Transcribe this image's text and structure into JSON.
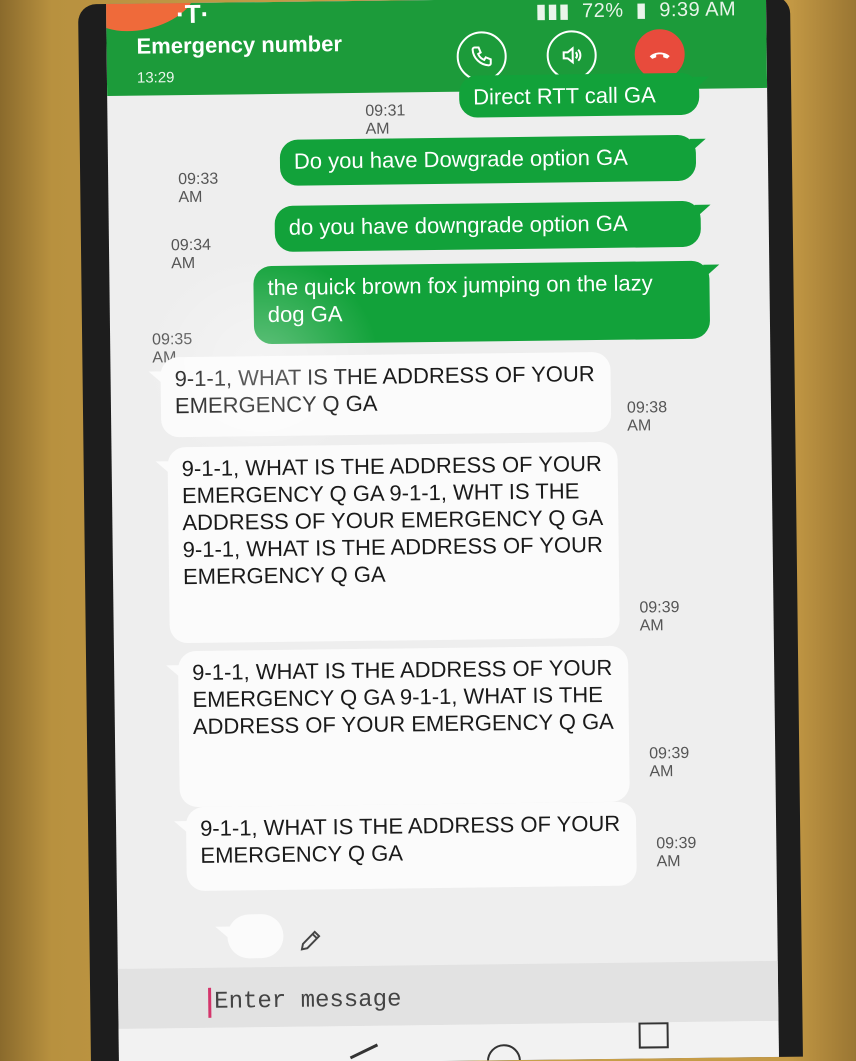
{
  "status_bar": {
    "battery": "72%",
    "clock": "9:39 AM"
  },
  "call": {
    "title": "Emergency number",
    "timer": "13:29"
  },
  "messages": [
    {
      "direction": "sent",
      "text": "Direct RTT call GA",
      "time": "09:31 AM"
    },
    {
      "direction": "sent",
      "text": "Do you have Dowgrade option GA",
      "time": "09:33 AM"
    },
    {
      "direction": "sent",
      "text": "do you have downgrade option GA",
      "time": "09:34 AM"
    },
    {
      "direction": "sent",
      "text": "the quick brown fox jumping on the lazy dog GA",
      "time": "09:35 AM"
    },
    {
      "direction": "received",
      "text": "9-1-1, WHAT IS THE ADDRESS OF YOUR EMERGENCY Q GA",
      "time": "09:38 AM"
    },
    {
      "direction": "received",
      "text": "9-1-1, WHAT IS THE ADDRESS OF YOUR EMERGENCY Q GA 9-1-1, WHT IS THE ADDRESS OF YOUR EMERGENCY Q GA 9-1-1, WHAT IS THE ADDRESS OF YOUR EMERGENCY Q GA",
      "time": "09:39 AM"
    },
    {
      "direction": "received",
      "text": "9-1-1, WHAT IS THE ADDRESS OF YOUR EMERGENCY Q GA 9-1-1, WHAT IS THE ADDRESS OF YOUR EMERGENCY Q GA",
      "time": "09:39 AM"
    },
    {
      "direction": "received",
      "text": "9-1-1, WHAT IS THE ADDRESS OF YOUR EMERGENCY Q GA",
      "time": "09:39 AM"
    }
  ],
  "compose": {
    "placeholder": "Enter message"
  },
  "colors": {
    "header_green": "#1c9b3a",
    "sent_bubble": "#12a23a",
    "received_bubble": "#fbfbfb",
    "hangup_red": "#e84b3c"
  },
  "icons": {
    "call": "phone-icon",
    "speaker": "speaker-icon",
    "hangup": "hangup-icon",
    "edit": "pencil-icon"
  }
}
